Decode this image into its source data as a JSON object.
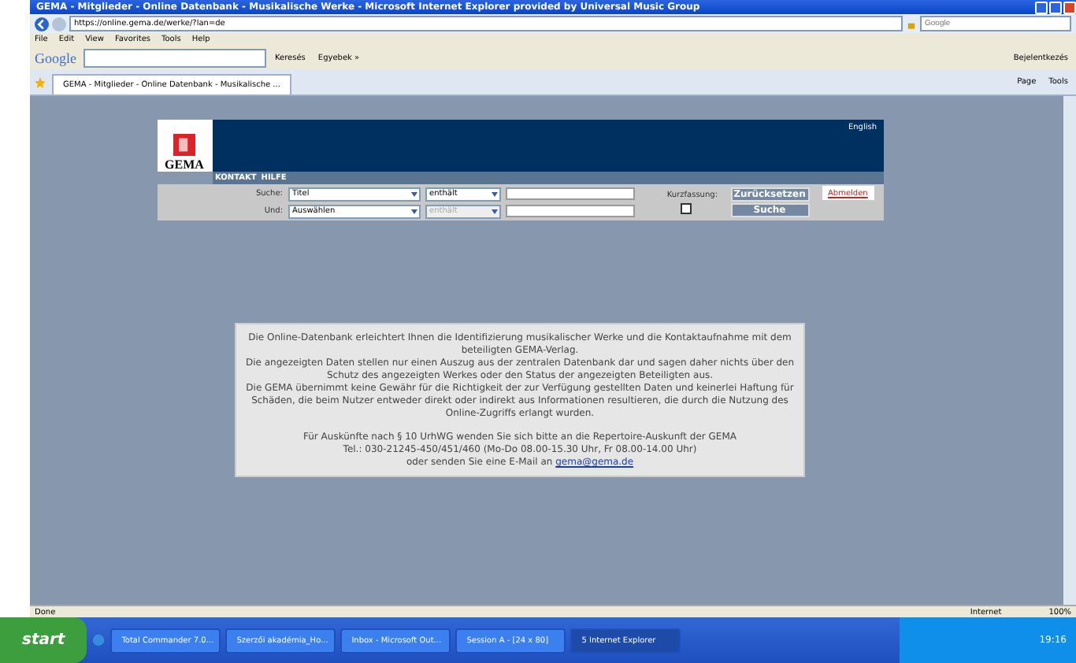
{
  "window": {
    "title": "GEMA - Mitglieder - Online Datenbank - Musikalische Werke - Microsoft Internet Explorer provided by Universal Music Group"
  },
  "address_bar": {
    "url": "https://online.gema.de/werke/?lan=de",
    "search_placeholder": "Google"
  },
  "menu": [
    "File",
    "Edit",
    "View",
    "Favorites",
    "Tools",
    "Help"
  ],
  "google_toolbar": {
    "logo": "Google",
    "search_button": "Keresés",
    "more": "Egyebek »",
    "login": "Bejelentkezés"
  },
  "tab": {
    "title": "GEMA - Mitglieder - Online Datenbank - Musikalische ...",
    "selected": true
  },
  "command_bar": [
    "Page",
    "Tools"
  ],
  "page": {
    "logo_text": "GEMA",
    "language_link": "English",
    "nav": [
      "KONTAKT",
      "HILFE"
    ],
    "search_rows": [
      {
        "label": "Suche:",
        "field": "Titel",
        "operator": "enthält",
        "operator_disabled": false
      },
      {
        "label": "Und:",
        "field": "Auswählen",
        "operator": "enthält",
        "operator_disabled": true
      }
    ],
    "short_label": "Kurzfassung:",
    "short_checked": false,
    "reset_button": "Zurücksetzen",
    "search_button": "Suche",
    "login_link": "Abmelden",
    "info": [
      "Die Online-Datenbank erleichtert Ihnen die Identifizierung musikalischer Werke und die Kontaktaufnahme mit dem beteiligten GEMA-Verlag.",
      "Die angezeigten Daten stellen nur einen Auszug aus der zentralen Datenbank dar und sagen daher nichts über den Schutz des angezeigten Werkes oder den Status der angezeigten Beteiligten aus.",
      "Die GEMA übernimmt keine Gewähr für die Richtigkeit der zur Verfügung gestellten Daten und keinerlei Haftung für Schäden, die beim Nutzer entweder direkt oder indirekt aus Informationen resultieren, die durch die Nutzung des Online-Zugriffs erlangt wurden."
    ],
    "contact": [
      "Für Auskünfte nach § 10 UrhWG wenden Sie sich bitte an die Repertoire-Auskunft der GEMA",
      "Tel.: 030-21245-450/451/460 (Mo-Do 08.00-15.30 Uhr, Fr 08.00-14.00 Uhr)"
    ],
    "mail_prefix": "oder senden Sie eine E-Mail an",
    "mail": "gema@gema.de"
  },
  "status_bar": {
    "text": "Done",
    "zone": "Internet",
    "zoom": "100%"
  },
  "taskbar": {
    "start": "start",
    "items": [
      {
        "label": "Total Commander 7.0...",
        "selected": false
      },
      {
        "label": "Szerzői akadémia_Ho...",
        "selected": false
      },
      {
        "label": "Inbox - Microsoft Out...",
        "selected": false
      },
      {
        "label": "Session A - [24 x 80]",
        "selected": false
      },
      {
        "label": "5 Internet Explorer",
        "selected": true
      }
    ],
    "clock": "19:16"
  }
}
